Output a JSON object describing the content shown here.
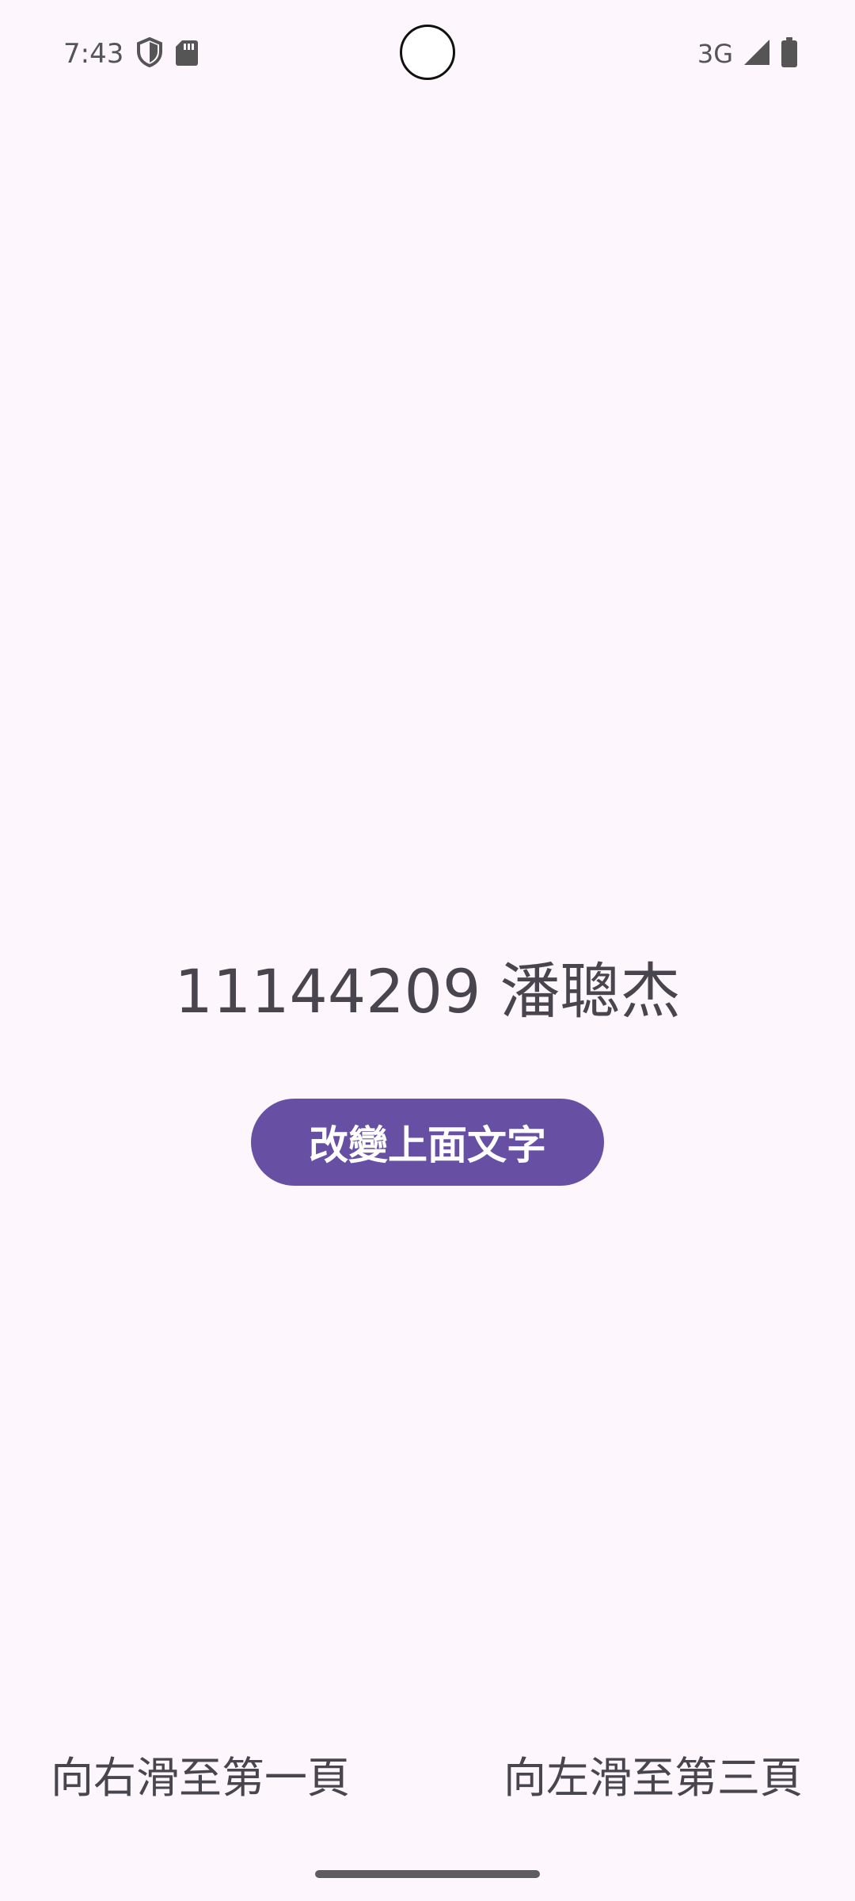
{
  "status_bar": {
    "time": "7:43",
    "network": "3G",
    "icons": [
      "shield-icon",
      "sd-card-icon",
      "signal-icon",
      "battery-icon"
    ]
  },
  "main": {
    "display_text": "11144209 潘聰杰",
    "button_label": "改變上面文字"
  },
  "footer": {
    "left_hint": "向右滑至第一頁",
    "right_hint": "向左滑至第三頁"
  },
  "colors": {
    "background": "#fdf6fd",
    "accent": "#6750a4",
    "text": "#49454f"
  }
}
